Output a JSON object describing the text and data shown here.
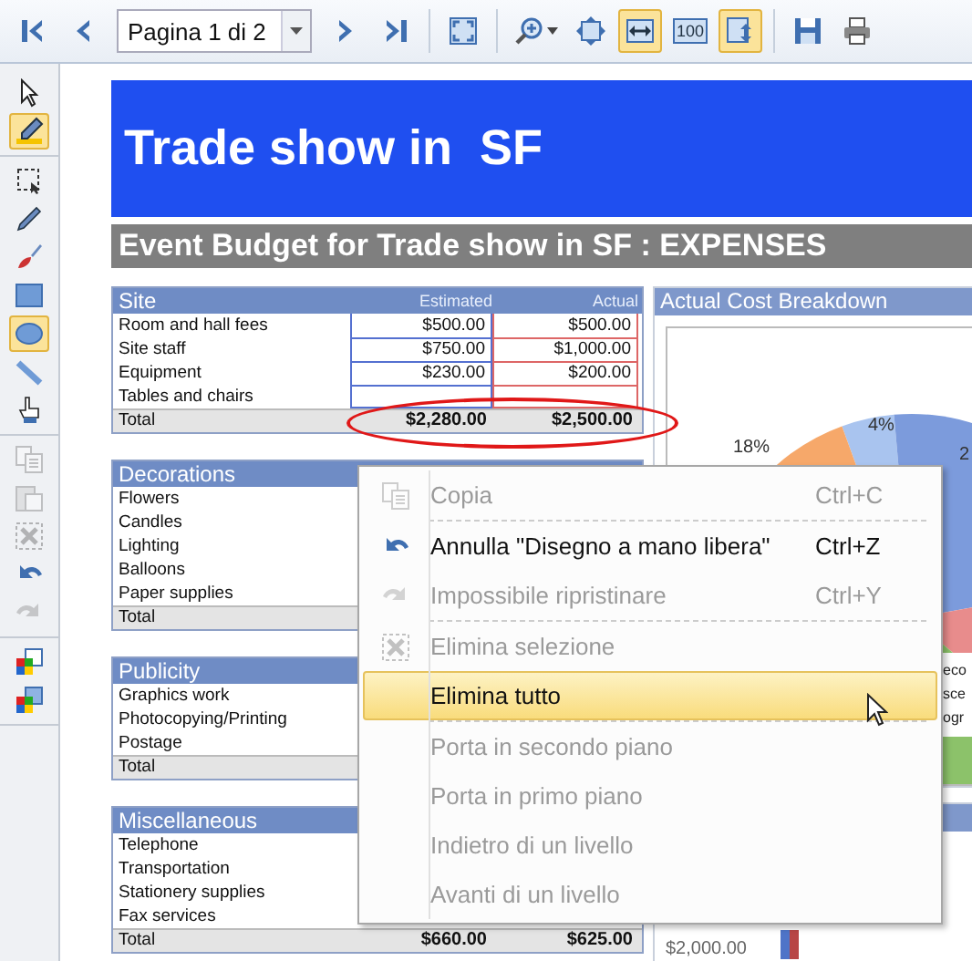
{
  "toolbar": {
    "nav_before": [
      {
        "kind": "first",
        "selected": false
      },
      {
        "kind": "prev",
        "selected": false
      }
    ],
    "page_field": "Pagina 1 di 2",
    "groups": [
      [
        {
          "kind": "next",
          "selected": false
        },
        {
          "kind": "last",
          "selected": false
        }
      ],
      [
        {
          "kind": "fit-page",
          "selected": false
        }
      ],
      [
        {
          "kind": "zoom",
          "selected": false
        },
        {
          "kind": "pan",
          "selected": false
        },
        {
          "kind": "fit-width",
          "selected": true
        },
        {
          "kind": "actual-size",
          "selected": false,
          "label": "100"
        },
        {
          "kind": "fit-height",
          "selected": true
        }
      ],
      [
        {
          "kind": "save",
          "selected": false
        },
        {
          "kind": "print",
          "selected": false
        }
      ]
    ]
  },
  "tools": [
    [
      {
        "kind": "pointer",
        "selected": false,
        "disabled": false
      },
      {
        "kind": "highlighter",
        "selected": true,
        "disabled": false
      }
    ],
    [
      {
        "kind": "select",
        "selected": false,
        "disabled": false
      },
      {
        "kind": "pencil",
        "selected": false,
        "disabled": false
      },
      {
        "kind": "brush",
        "selected": false,
        "disabled": false
      },
      {
        "kind": "rectangle",
        "selected": false,
        "disabled": false
      },
      {
        "kind": "ellipse",
        "selected": true,
        "disabled": false
      },
      {
        "kind": "line",
        "selected": false,
        "disabled": false
      },
      {
        "kind": "fill",
        "selected": false,
        "disabled": false
      }
    ],
    [
      {
        "kind": "copy",
        "selected": false,
        "disabled": true
      },
      {
        "kind": "paste",
        "selected": false,
        "disabled": true
      },
      {
        "kind": "delete",
        "selected": false,
        "disabled": true
      },
      {
        "kind": "undo",
        "selected": false,
        "disabled": false
      },
      {
        "kind": "redo",
        "selected": false,
        "disabled": true
      }
    ],
    [
      {
        "kind": "front",
        "selected": false,
        "disabled": false
      },
      {
        "kind": "back",
        "selected": false,
        "disabled": false
      }
    ]
  ],
  "document": {
    "title": "Trade show in  SF",
    "subtitle": "Event Budget for Trade show in SF : EXPENSES",
    "sections": [
      {
        "title": "Site",
        "columns": [
          "Estimated",
          "Actual"
        ],
        "rows": [
          {
            "label": "Room and hall fees",
            "estimated": "$500.00",
            "actual": "$500.00"
          },
          {
            "label": "Site staff",
            "estimated": "$750.00",
            "actual": "$1,000.00"
          },
          {
            "label": "Equipment",
            "estimated": "$230.00",
            "actual": "$200.00"
          },
          {
            "label": "Tables and chairs"
          }
        ],
        "total": {
          "label": "Total",
          "estimated": "$2,280.00",
          "actual": "$2,500.00"
        },
        "circled": true
      },
      {
        "title": "Decorations",
        "rows": [
          {
            "label": "Flowers"
          },
          {
            "label": "Candles"
          },
          {
            "label": "Lighting"
          },
          {
            "label": "Balloons"
          },
          {
            "label": "Paper supplies"
          }
        ],
        "total": {
          "label": "Total"
        },
        "circled": false
      },
      {
        "title": "Publicity",
        "rows": [
          {
            "label": "Graphics work"
          },
          {
            "label": "Photocopying/Printing"
          },
          {
            "label": "Postage"
          }
        ],
        "total": {
          "label": "Total"
        },
        "circled": false
      },
      {
        "title": "Miscellaneous",
        "rows": [
          {
            "label": "Telephone"
          },
          {
            "label": "Transportation"
          },
          {
            "label": "Stationery supplies"
          },
          {
            "label": "Fax services"
          }
        ],
        "total": {
          "label": "Total",
          "estimated": "$660.00",
          "actual": "$625.00"
        },
        "circled": false
      }
    ],
    "chart_panel": {
      "title": "Actual Cost Breakdown",
      "slice_labels": [
        "18%",
        "4%",
        "2"
      ],
      "legend": [
        "eco",
        "sce",
        "ogr"
      ]
    },
    "second_panel": {
      "axis_label": "$2,000.00"
    }
  },
  "context_menu": {
    "items": [
      {
        "label": "Copia",
        "shortcut": "Ctrl+C",
        "kind": "copy",
        "disabled": true,
        "selected": false,
        "separator_after": true
      },
      {
        "label": "Annulla \"Disegno a mano libera\"",
        "shortcut": "Ctrl+Z",
        "kind": "undo",
        "disabled": false,
        "selected": false,
        "separator_after": false
      },
      {
        "label": "Impossibile ripristinare",
        "shortcut": "Ctrl+Y",
        "kind": "redo",
        "disabled": true,
        "selected": false,
        "separator_after": true
      },
      {
        "label": "Elimina selezione",
        "kind": "delete",
        "disabled": true,
        "selected": false,
        "separator_after": false
      },
      {
        "label": "Elimina tutto",
        "kind": "text",
        "disabled": false,
        "selected": true,
        "separator_after": true
      },
      {
        "label": "Porta in secondo piano",
        "kind": "text",
        "disabled": true,
        "selected": false,
        "separator_after": false
      },
      {
        "label": "Porta in primo piano",
        "kind": "text",
        "disabled": true,
        "selected": false,
        "separator_after": false
      },
      {
        "label": "Indietro di un livello",
        "kind": "text",
        "disabled": true,
        "selected": false,
        "separator_after": false
      },
      {
        "label": "Avanti di un livello",
        "kind": "text",
        "disabled": true,
        "selected": false,
        "separator_after": false
      }
    ]
  }
}
